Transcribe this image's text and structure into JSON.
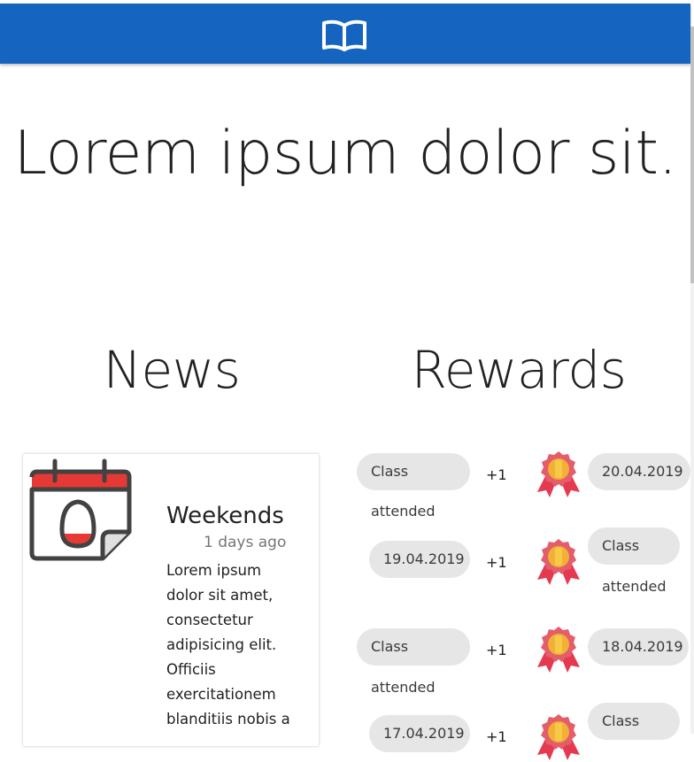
{
  "header": {
    "icon": "book-icon",
    "color": "#1565c0"
  },
  "hero": {
    "title": "Lorem ipsum dolor sit."
  },
  "news": {
    "heading": "News",
    "items": [
      {
        "icon": "calendar-egg-icon",
        "title": "Weekends",
        "ago": "1 days ago",
        "body": "Lorem ipsum dolor sit amet, consectetur adipisicing elit. Officiis exercitationem blanditiis nobis a"
      }
    ]
  },
  "rewards": {
    "heading": "Rewards",
    "rows": [
      {
        "left_label_top": "Class",
        "left_label_bottom": "attended",
        "points": "+1",
        "right": "20.04.2019",
        "icon": "medal-icon"
      },
      {
        "left": "19.04.2019",
        "points": "+1",
        "right_label_top": "Class",
        "right_label_bottom": "attended",
        "icon": "medal-icon"
      },
      {
        "left_label_top": "Class",
        "left_label_bottom": "attended",
        "points": "+1",
        "right": "18.04.2019",
        "icon": "medal-icon"
      },
      {
        "left": "17.04.2019",
        "points": "+1",
        "right_label_top": "Class",
        "icon": "medal-icon"
      }
    ]
  }
}
